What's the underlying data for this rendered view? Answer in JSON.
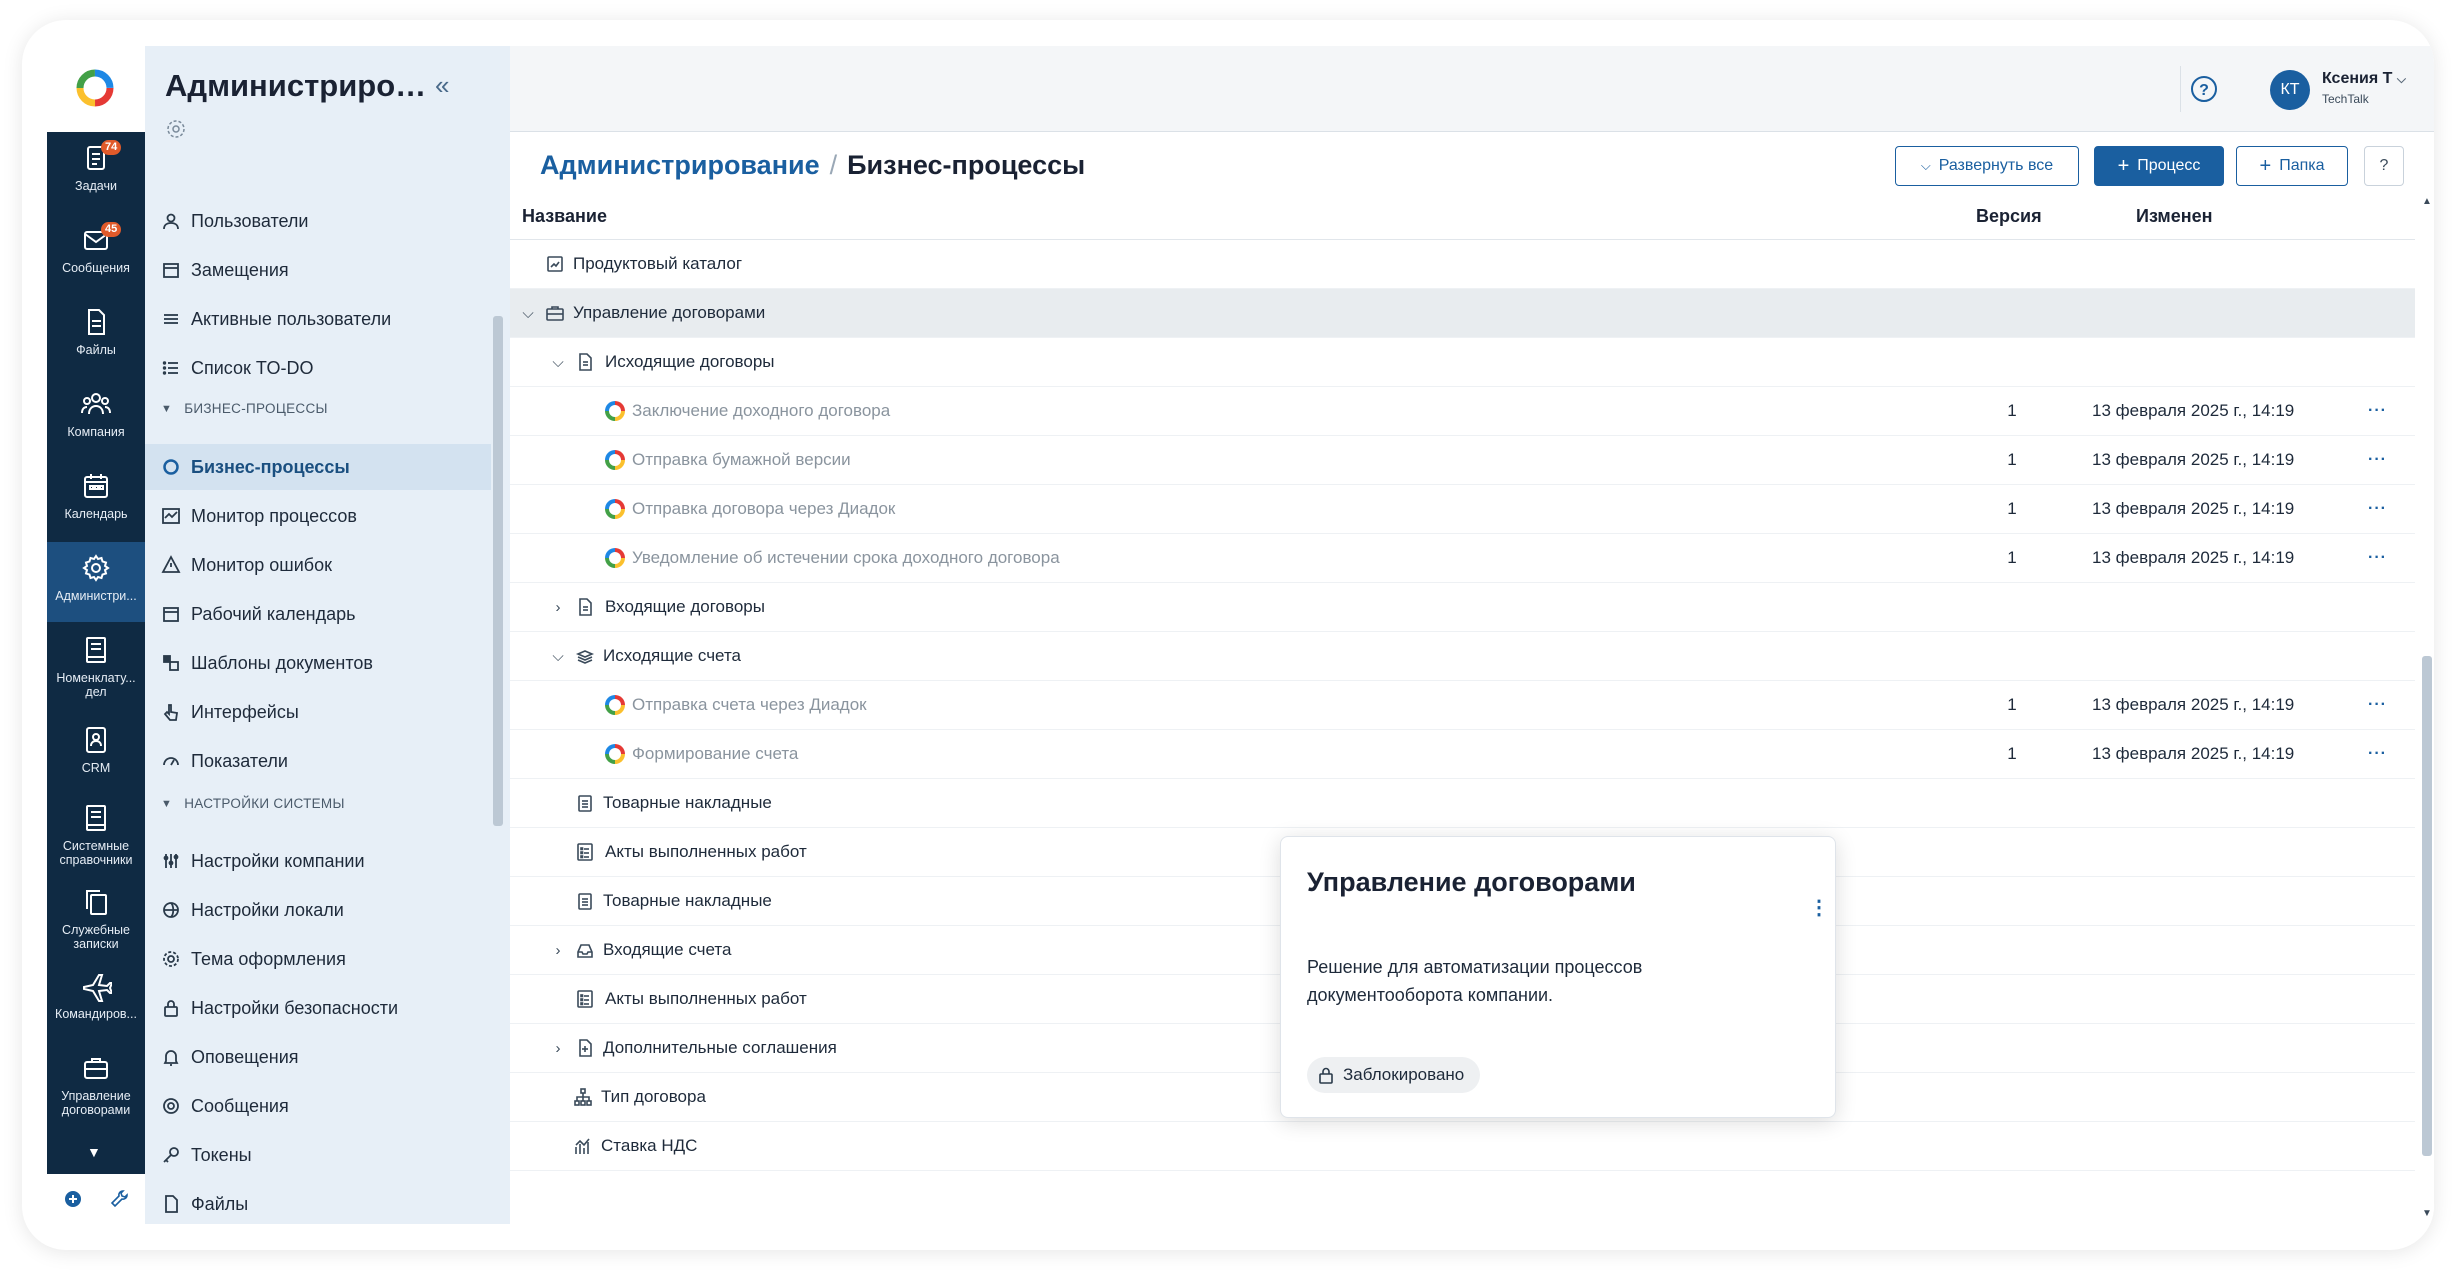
{
  "rail": {
    "items": [
      {
        "label": "Задачи",
        "icon": "tasks-icon",
        "badge": "74"
      },
      {
        "label": "Сообщения",
        "icon": "messages-icon",
        "badge": "45"
      },
      {
        "label": "Файлы",
        "icon": "files-icon"
      },
      {
        "label": "Компания",
        "icon": "company-icon"
      },
      {
        "label": "Календарь",
        "icon": "calendar-icon"
      },
      {
        "label": "Администри...",
        "icon": "settings-icon"
      },
      {
        "label": "Номенклату...\nдел",
        "icon": "book-icon"
      },
      {
        "label": "CRM",
        "icon": "crm-icon"
      },
      {
        "label": "Системные\nсправочники",
        "icon": "book-icon"
      },
      {
        "label": "Служебные\nзаписки",
        "icon": "copy-icon"
      },
      {
        "label": "Командиров...",
        "icon": "plane-icon"
      },
      {
        "label": "Управление\nдоговорами",
        "icon": "briefcase-icon"
      }
    ]
  },
  "sidebar": {
    "title": "Администриров...",
    "items_top": [
      "Пользователи",
      "Замещения",
      "Активные пользователи",
      "Список TO-DO"
    ],
    "section1": "БИЗНЕС-ПРОЦЕССЫ",
    "items_bp": [
      "Бизнес-процессы",
      "Монитор процессов",
      "Монитор ошибок",
      "Рабочий календарь",
      "Шаблоны документов",
      "Интерфейсы",
      "Показатели"
    ],
    "section2": "НАСТРОЙКИ СИСТЕМЫ",
    "items_sys": [
      "Настройки компании",
      "Настройки локали",
      "Тема оформления",
      "Настройки безопасности",
      "Оповещения",
      "Сообщения",
      "Токены",
      "Файлы"
    ]
  },
  "user": {
    "initials": "КТ",
    "name": "Ксения Т",
    "org": "TechTalk"
  },
  "header": {
    "crumb_root": "Администрирование",
    "crumb_sep": "/",
    "crumb_current": "Бизнес-процессы",
    "expand_label": "Развернуть все",
    "process_label": "Процесс",
    "folder_label": "Папка"
  },
  "table": {
    "col_name": "Название",
    "col_version": "Версия",
    "col_changed": "Изменен",
    "rows": [
      {
        "name": "Продуктовый каталог",
        "version": "",
        "date": ""
      },
      {
        "name": "Управление договорами",
        "version": "",
        "date": ""
      },
      {
        "name": "Исходящие договоры",
        "version": "",
        "date": ""
      },
      {
        "name": "Заключение доходного договора",
        "version": "1",
        "date": "13 февраля 2025 г., 14:19"
      },
      {
        "name": "Отправка бумажной версии",
        "version": "1",
        "date": "13 февраля 2025 г., 14:19"
      },
      {
        "name": "Отправка договора через Диадок",
        "version": "1",
        "date": "13 февраля 2025 г., 14:19"
      },
      {
        "name": "Уведомление об истечении срока доходного договора",
        "version": "1",
        "date": "13 февраля 2025 г., 14:19"
      },
      {
        "name": "Входящие договоры",
        "version": "",
        "date": ""
      },
      {
        "name": "Исходящие счета",
        "version": "",
        "date": ""
      },
      {
        "name": "Отправка счета через Диадок",
        "version": "1",
        "date": "13 февраля 2025 г., 14:19"
      },
      {
        "name": "Формирование счета",
        "version": "1",
        "date": "13 февраля 2025 г., 14:19"
      },
      {
        "name": "Товарные накладные",
        "version": "",
        "date": ""
      },
      {
        "name": "Акты выполненных работ",
        "version": "",
        "date": ""
      },
      {
        "name": "Товарные накладные",
        "version": "",
        "date": ""
      },
      {
        "name": "Входящие счета",
        "version": "",
        "date": ""
      },
      {
        "name": "Акты выполненных работ",
        "version": "",
        "date": ""
      },
      {
        "name": "Дополнительные соглашения",
        "version": "",
        "date": ""
      },
      {
        "name": "Тип договора",
        "version": "",
        "date": ""
      },
      {
        "name": "Ставка НДС",
        "version": "",
        "date": ""
      }
    ]
  },
  "popover": {
    "title": "Управление договорами",
    "description": "Решение для автоматизации процессов документооборота компании.",
    "badge": "Заблокировано"
  },
  "colors": {
    "accent": "#1a5fa0",
    "rail": "#0f2a43",
    "rail_active": "#1d4f7f",
    "sidebar": "#e7eff7",
    "badge": "#e05a2a"
  }
}
